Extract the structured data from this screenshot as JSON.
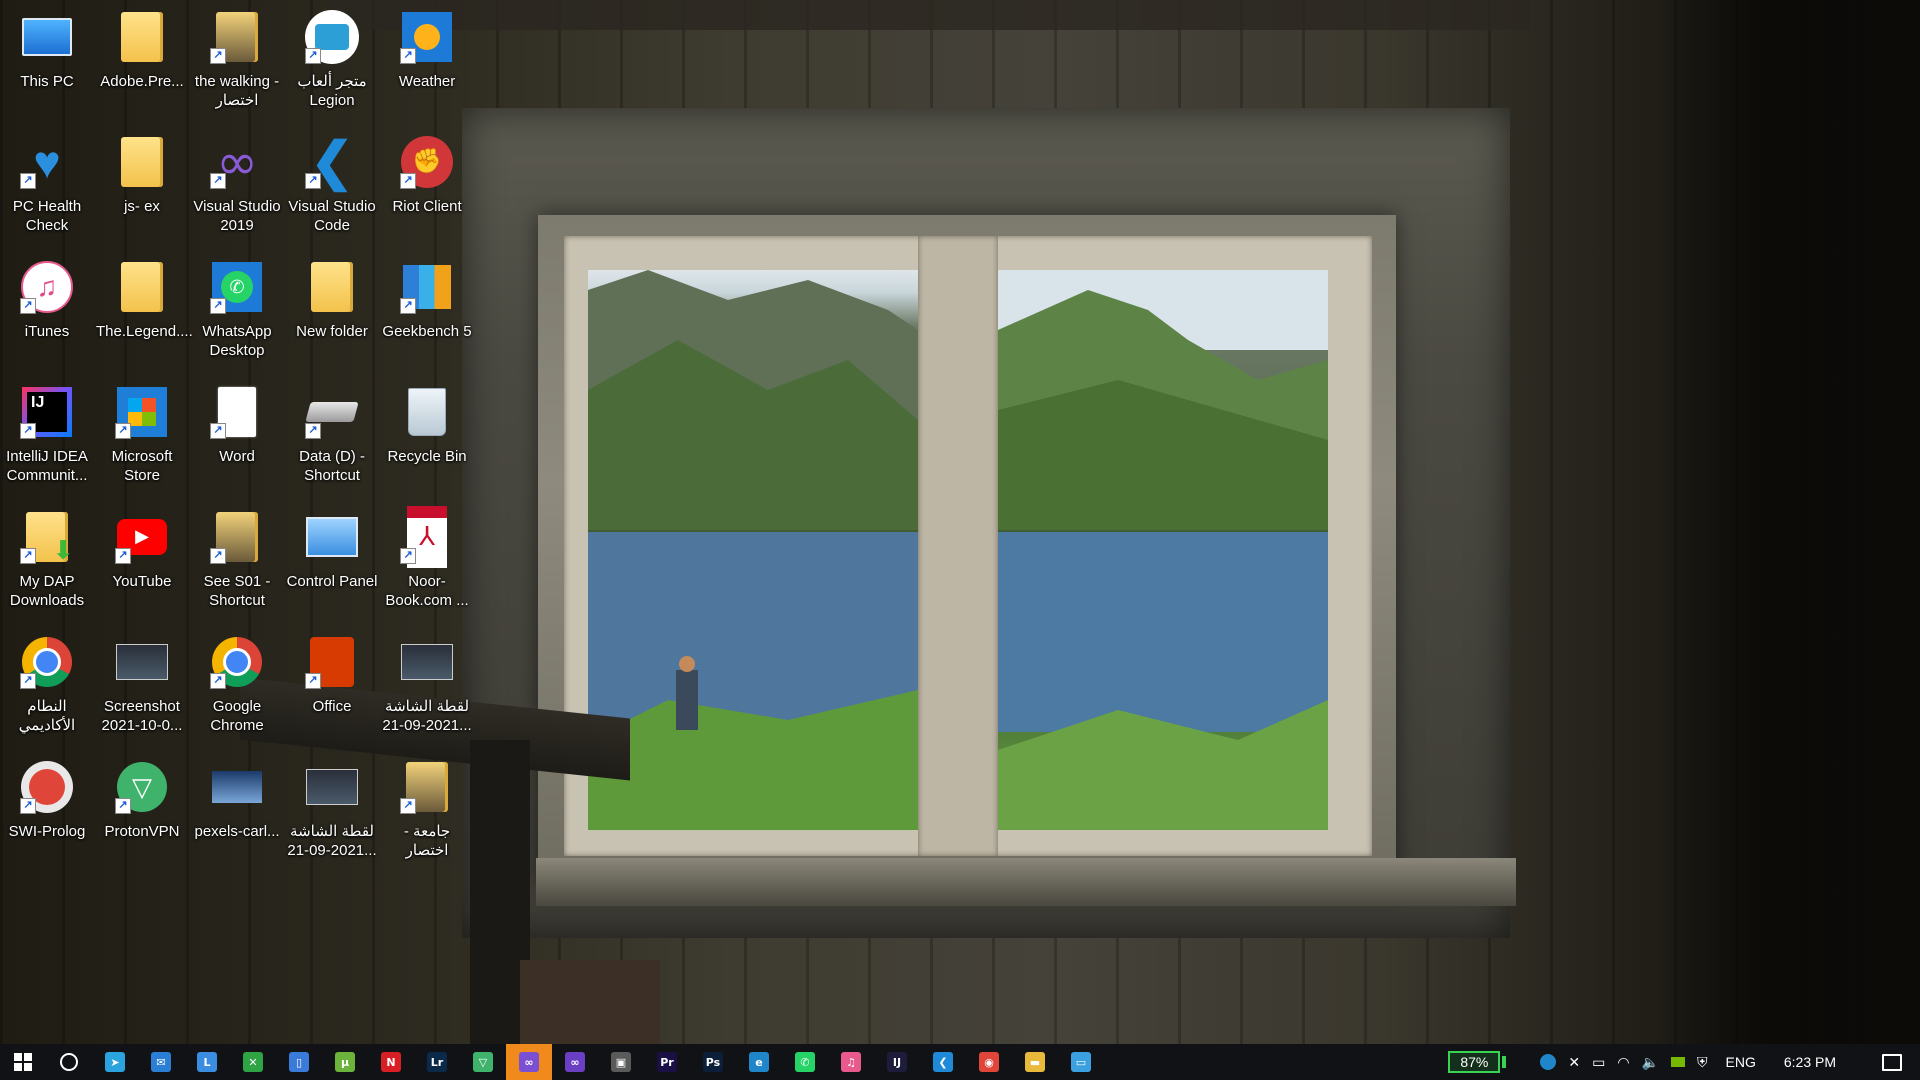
{
  "desktop": {
    "icons": [
      {
        "label": "This PC",
        "icon": "computer-icon",
        "shortcut": false
      },
      {
        "label": "Adobe.Pre...",
        "icon": "folder-icon",
        "shortcut": false
      },
      {
        "label": "the walking - اختصار",
        "icon": "folder-shortcut-icon",
        "shortcut": true
      },
      {
        "label": "متجر ألعاب Legion",
        "icon": "legion-store-icon",
        "shortcut": true
      },
      {
        "label": "Weather",
        "icon": "weather-icon",
        "shortcut": true
      },
      {
        "label": "PC Health Check",
        "icon": "health-check-icon",
        "shortcut": true
      },
      {
        "label": "js- ex",
        "icon": "folder-icon",
        "shortcut": false
      },
      {
        "label": "Visual Studio 2019",
        "icon": "visual-studio-icon",
        "shortcut": true
      },
      {
        "label": "Visual Studio Code",
        "icon": "vscode-icon",
        "shortcut": true
      },
      {
        "label": "Riot Client",
        "icon": "riot-icon",
        "shortcut": true
      },
      {
        "label": "iTunes",
        "icon": "itunes-icon",
        "shortcut": true
      },
      {
        "label": "The.Legend....",
        "icon": "folder-icon",
        "shortcut": false
      },
      {
        "label": "WhatsApp Desktop",
        "icon": "whatsapp-icon",
        "shortcut": true
      },
      {
        "label": "New folder",
        "icon": "folder-icon",
        "shortcut": false
      },
      {
        "label": "Geekbench 5",
        "icon": "geekbench-icon",
        "shortcut": true
      },
      {
        "label": "IntelliJ IDEA Communit...",
        "icon": "intellij-icon",
        "shortcut": true
      },
      {
        "label": "Microsoft Store",
        "icon": "store-icon",
        "shortcut": true
      },
      {
        "label": "Word",
        "icon": "document-icon",
        "shortcut": true
      },
      {
        "label": "Data (D) - Shortcut",
        "icon": "drive-icon",
        "shortcut": true
      },
      {
        "label": "Recycle Bin",
        "icon": "recycle-bin-icon",
        "shortcut": false
      },
      {
        "label": "My DAP Downloads",
        "icon": "downloads-folder-icon",
        "shortcut": true
      },
      {
        "label": "YouTube",
        "icon": "youtube-icon",
        "shortcut": true
      },
      {
        "label": "See S01 - Shortcut",
        "icon": "folder-shortcut-icon",
        "shortcut": true
      },
      {
        "label": "Control Panel",
        "icon": "control-panel-icon",
        "shortcut": false
      },
      {
        "label": "Noor-Book.com ...",
        "icon": "pdf-icon",
        "shortcut": true
      },
      {
        "label": "النطام الأكاديمي",
        "icon": "chrome-icon",
        "shortcut": true
      },
      {
        "label": "Screenshot 2021-10-0...",
        "icon": "screenshot-file-icon",
        "shortcut": false
      },
      {
        "label": "Google Chrome",
        "icon": "chrome-icon",
        "shortcut": true
      },
      {
        "label": "Office",
        "icon": "office-icon",
        "shortcut": true
      },
      {
        "label": "لقطة الشاشة 2021-09-21...",
        "icon": "screenshot-file-icon",
        "shortcut": false
      },
      {
        "label": "SWI-Prolog",
        "icon": "swi-prolog-icon",
        "shortcut": true
      },
      {
        "label": "ProtonVPN",
        "icon": "protonvpn-icon",
        "shortcut": true
      },
      {
        "label": "pexels-carl...",
        "icon": "image-file-icon",
        "shortcut": false
      },
      {
        "label": "لقطة الشاشة 2021-09-21...",
        "icon": "screenshot-file-icon",
        "shortcut": false
      },
      {
        "label": "جامعة - اختصار",
        "icon": "folder-shortcut-icon",
        "shortcut": true
      }
    ]
  },
  "taskbar": {
    "apps": [
      {
        "icon": "windows-start-icon",
        "glyph": "",
        "color": "#ffffff"
      },
      {
        "icon": "search-icon",
        "glyph": "",
        "color": "#ffffff"
      },
      {
        "icon": "telegram-icon",
        "glyph": "➤",
        "color": "#2aa3df"
      },
      {
        "icon": "mail-icon",
        "glyph": "✉",
        "color": "#2a7fd4"
      },
      {
        "icon": "lenovo-l-icon",
        "glyph": "L",
        "color": "#3a8de0"
      },
      {
        "icon": "xbox-icon",
        "glyph": "✕",
        "color": "#2fa444"
      },
      {
        "icon": "phone-icon",
        "glyph": "▯",
        "color": "#3a7ad8"
      },
      {
        "icon": "utorrent-icon",
        "glyph": "µ",
        "color": "#6bb33b"
      },
      {
        "icon": "netflix-icon",
        "glyph": "N",
        "color": "#d81f26"
      },
      {
        "icon": "lightroom-icon",
        "glyph": "Lr",
        "color": "#0b2a4a"
      },
      {
        "icon": "protonvpn-icon",
        "glyph": "▽",
        "color": "#3fb36b"
      },
      {
        "icon": "visual-studio-icon",
        "glyph": "∞",
        "color": "#7b4fd1"
      },
      {
        "icon": "visual-studio-icon",
        "glyph": "∞",
        "color": "#6b3fc4"
      },
      {
        "icon": "store-icon",
        "glyph": "▣",
        "color": "#5a5a5a"
      },
      {
        "icon": "premiere-icon",
        "glyph": "Pr",
        "color": "#1a1046"
      },
      {
        "icon": "photoshop-icon",
        "glyph": "Ps",
        "color": "#0b1f3a"
      },
      {
        "icon": "edge-icon",
        "glyph": "e",
        "color": "#1e86c9"
      },
      {
        "icon": "whatsapp-icon",
        "glyph": "✆",
        "color": "#25d366"
      },
      {
        "icon": "itunes-icon",
        "glyph": "♫",
        "color": "#e85a8c"
      },
      {
        "icon": "intellij-icon",
        "glyph": "IJ",
        "color": "#1d1d3b"
      },
      {
        "icon": "vscode-icon",
        "glyph": "❮",
        "color": "#1e8ad8"
      },
      {
        "icon": "chrome-icon",
        "glyph": "◉",
        "color": "#e0453a"
      },
      {
        "icon": "file-explorer-icon",
        "glyph": "▬",
        "color": "#e8b93a"
      },
      {
        "icon": "monitor-app-icon",
        "glyph": "▭",
        "color": "#3aa0e0"
      }
    ],
    "active_index": 11,
    "tray": {
      "battery": "87%",
      "language": "ENG",
      "time": "6:23 PM"
    }
  }
}
